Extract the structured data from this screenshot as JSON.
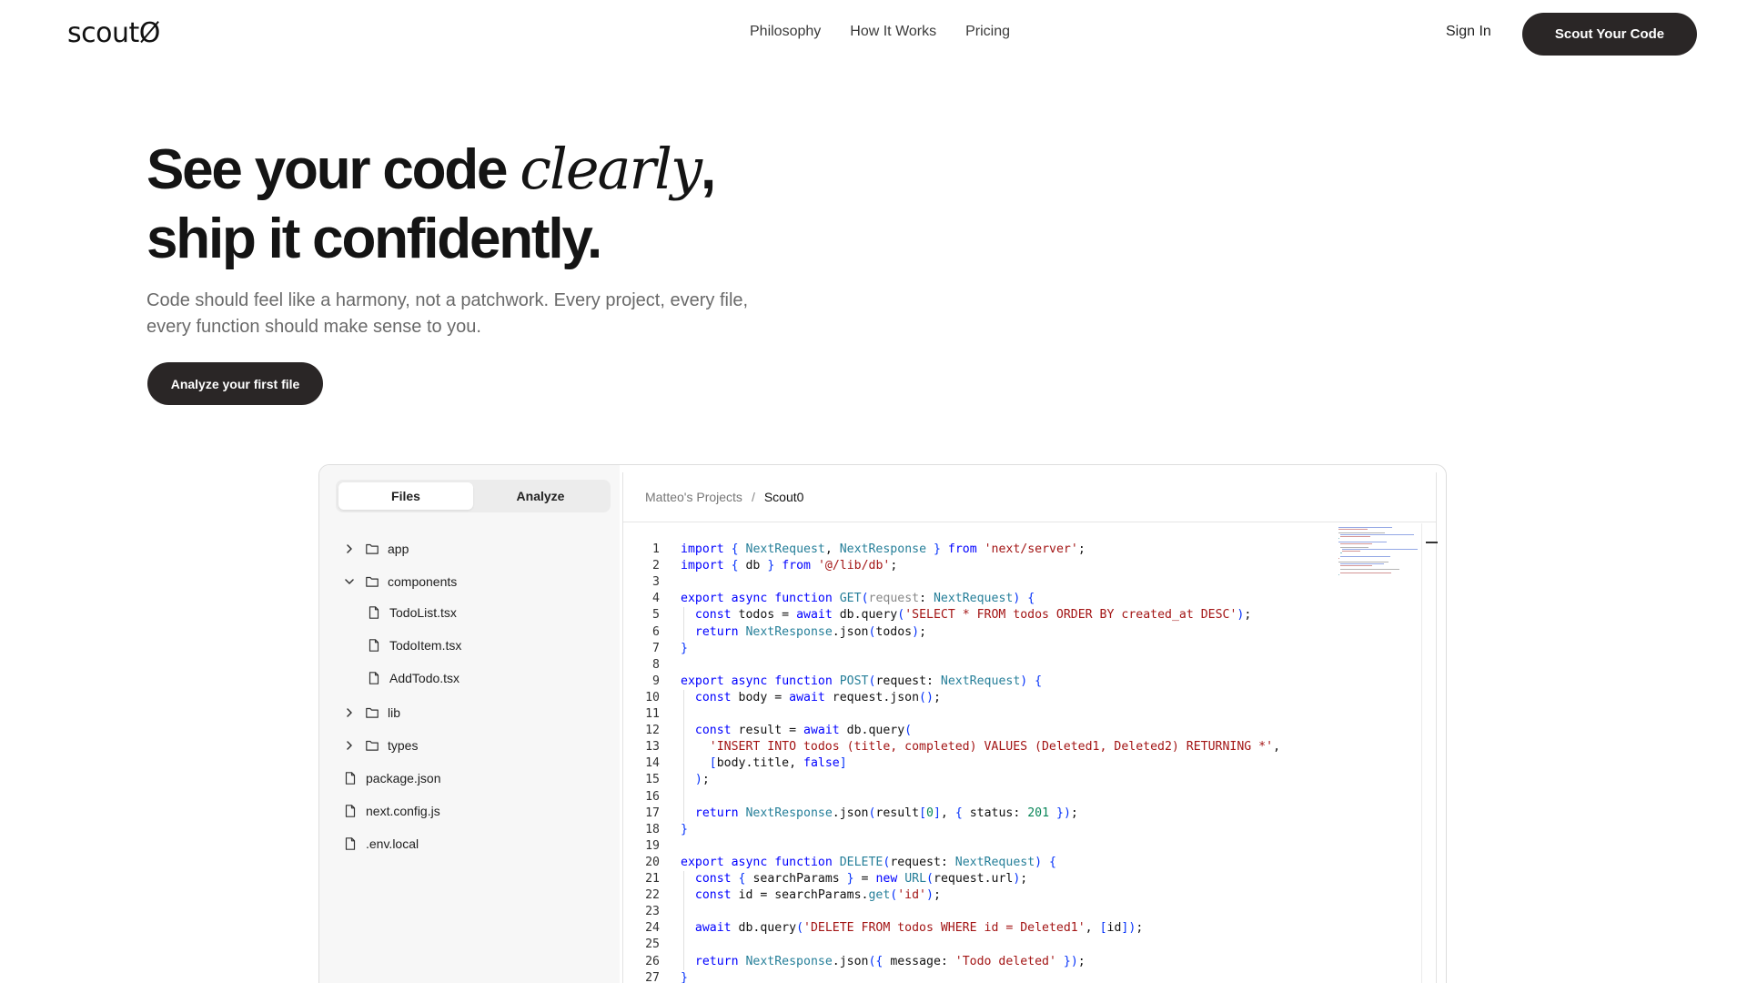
{
  "nav": {
    "logo": "scoutØ",
    "links": [
      "Philosophy",
      "How It Works",
      "Pricing"
    ],
    "sign_in": "Sign In",
    "cta": "Scout Your Code"
  },
  "hero": {
    "title_part1": "See your code ",
    "title_emphasis": "clearly",
    "title_part2": ",",
    "title_line2": "ship it confidently.",
    "subtitle": "Code should feel like a harmony, not a patchwork. Every project, every file, every function should make sense to you.",
    "cta": "Analyze your first file"
  },
  "app": {
    "tabs": [
      "Files",
      "Analyze"
    ],
    "active_tab": "Files",
    "breadcrumb": {
      "parent": "Matteo's Projects",
      "separator": "/",
      "current": "Scout0"
    },
    "tree": [
      {
        "label": "app",
        "type": "folder",
        "expanded": false
      },
      {
        "label": "components",
        "type": "folder",
        "expanded": true
      },
      {
        "label": "TodoList.tsx",
        "type": "file"
      },
      {
        "label": "TodoItem.tsx",
        "type": "file"
      },
      {
        "label": "AddTodo.tsx",
        "type": "file"
      },
      {
        "label": "lib",
        "type": "folder",
        "expanded": false
      },
      {
        "label": "types",
        "type": "folder",
        "expanded": false
      },
      {
        "label": "package.json",
        "type": "file"
      },
      {
        "label": "next.config.js",
        "type": "file"
      },
      {
        "label": ".env.local",
        "type": "file"
      }
    ],
    "code_lines": [
      "import { NextRequest, NextResponse } from 'next/server';",
      "import { db } from '@/lib/db';",
      "",
      "export async function GET(request: NextRequest) {",
      "  const todos = await db.query('SELECT * FROM todos ORDER BY created_at DESC');",
      "  return NextResponse.json(todos);",
      "}",
      "",
      "export async function POST(request: NextRequest) {",
      "  const body = await request.json();",
      "",
      "  const result = await db.query(",
      "    'INSERT INTO todos (title, completed) VALUES (Deleted1, Deleted2) RETURNING *',",
      "    [body.title, false]",
      "  );",
      "",
      "  return NextResponse.json(result[0], { status: 201 });",
      "}",
      "",
      "export async function DELETE(request: NextRequest) {",
      "  const { searchParams } = new URL(request.url);",
      "  const id = searchParams.get('id');",
      "",
      "  await db.query('DELETE FROM todos WHERE id = Deleted1', [id]);",
      "",
      "  return NextResponse.json({ message: 'Todo deleted' });",
      "}"
    ]
  },
  "icons": [
    "chevron-right-icon",
    "chevron-down-icon",
    "folder-icon",
    "file-icon"
  ]
}
